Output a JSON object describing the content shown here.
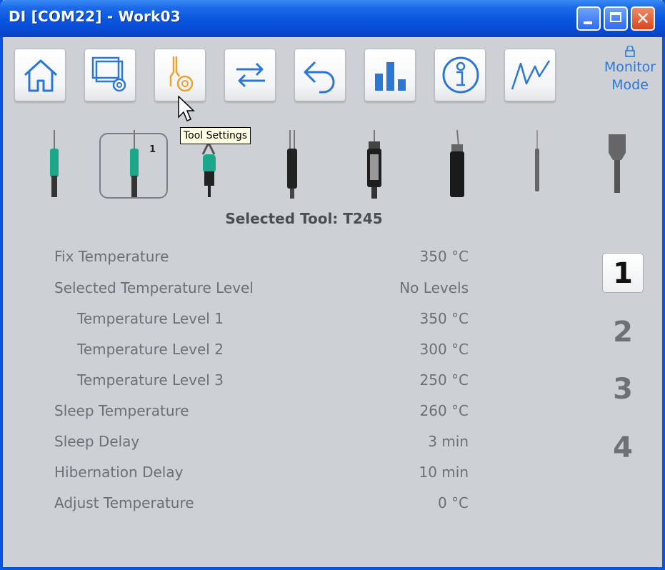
{
  "window": {
    "title": "DI [COM22] - Work03",
    "close_glyph": "✕"
  },
  "toolbar": {
    "buttons": [
      {
        "icon": "home-icon"
      },
      {
        "icon": "station-settings-icon"
      },
      {
        "icon": "tool-settings-icon"
      },
      {
        "icon": "transfer-icon"
      },
      {
        "icon": "undo-icon"
      },
      {
        "icon": "bar-chart-icon"
      },
      {
        "icon": "info-icon"
      },
      {
        "icon": "graph-icon"
      }
    ],
    "monitor_line1": "Monitor",
    "monitor_line2": "Mode",
    "tooltip": "Tool Settings"
  },
  "tools": {
    "selected_badge": "1"
  },
  "selected_tool_text": "Selected Tool: T245",
  "settings": [
    {
      "label": "Fix Temperature",
      "value": "350 °C"
    },
    {
      "label": "Selected Temperature Level",
      "value": "No Levels"
    },
    {
      "label": "Temperature Level 1",
      "value": "350 °C"
    },
    {
      "label": "Temperature Level 2",
      "value": "300 °C"
    },
    {
      "label": "Temperature Level 3",
      "value": "250 °C"
    },
    {
      "label": "Sleep Temperature",
      "value": "260 °C"
    },
    {
      "label": "Sleep Delay",
      "value": "3 min"
    },
    {
      "label": "Hibernation Delay",
      "value": "10 min"
    },
    {
      "label": "Adjust Temperature",
      "value": "0 °C"
    }
  ],
  "levels": [
    "1",
    "2",
    "3",
    "4"
  ],
  "colors": {
    "accent": "#2a77d6",
    "tool_settings_active": "#f0a030",
    "titlebar": "#0a55e0"
  }
}
